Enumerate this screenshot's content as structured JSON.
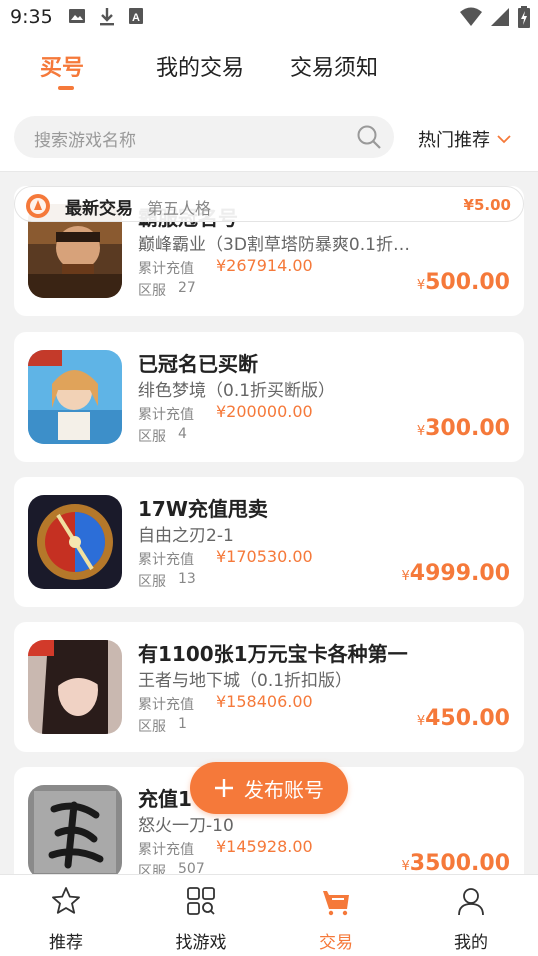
{
  "status_bar": {
    "time": "9:35",
    "icons_left": [
      "image-icon",
      "download-icon",
      "a-icon"
    ],
    "icons_right": [
      "wifi-icon",
      "signal-icon",
      "battery-icon"
    ]
  },
  "top_tabs": [
    {
      "label": "买号",
      "active": true
    },
    {
      "label": "我的交易",
      "active": false
    },
    {
      "label": "交易须知",
      "active": false
    }
  ],
  "search": {
    "placeholder": "搜索游戏名称"
  },
  "sort": {
    "label": "热门推荐"
  },
  "latest_trade": {
    "label": "最新交易",
    "game": "第五人格",
    "price": "¥5.00"
  },
  "listings": [
    {
      "title": "霸服冠名号",
      "game": "巅峰霸业（3D割草塔防暴爽0.1折…",
      "recharge_label": "累计充值",
      "recharge": "¥267914.00",
      "server_label": "区服",
      "server": "27",
      "price_symbol": "¥",
      "price": "500.00"
    },
    {
      "title": "已冠名已买断",
      "game": "绯色梦境（0.1折买断版）",
      "recharge_label": "累计充值",
      "recharge": "¥200000.00",
      "server_label": "区服",
      "server": "4",
      "price_symbol": "¥",
      "price": "300.00"
    },
    {
      "title": "17W充值甩卖",
      "game": "自由之刃2-1",
      "recharge_label": "累计充值",
      "recharge": "¥170530.00",
      "server_label": "区服",
      "server": "13",
      "price_symbol": "¥",
      "price": "4999.00"
    },
    {
      "title": "有1100张1万元宝卡各种第一",
      "game": "王者与地下城（0.1折扣版）",
      "recharge_label": "累计充值",
      "recharge": "¥158406.00",
      "server_label": "区服",
      "server": "1",
      "price_symbol": "¥",
      "price": "450.00"
    },
    {
      "title": "充值1",
      "game": "怒火一刀-10",
      "recharge_label": "累计充值",
      "recharge": "¥145928.00",
      "server_label": "区服",
      "server": "507",
      "price_symbol": "¥",
      "price": "3500.00"
    }
  ],
  "publish_button": {
    "label": "发布账号"
  },
  "bottom_nav": [
    {
      "label": "推荐",
      "icon": "star-icon",
      "active": false
    },
    {
      "label": "找游戏",
      "icon": "grid-search-icon",
      "active": false
    },
    {
      "label": "交易",
      "icon": "trade-cart-icon",
      "active": true
    },
    {
      "label": "我的",
      "icon": "person-icon",
      "active": false
    }
  ],
  "colors": {
    "accent": "#f5793a",
    "background": "#f2f2f2"
  }
}
